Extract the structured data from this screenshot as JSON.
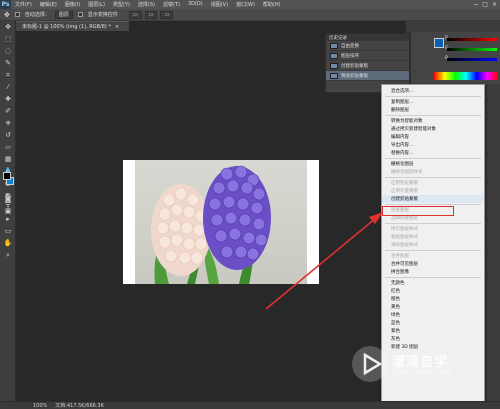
{
  "menubar": {
    "logo": "Ps",
    "items": [
      "文件(F)",
      "编辑(E)",
      "图像(I)",
      "图层(L)",
      "类型(Y)",
      "选择(S)",
      "滤镜(T)",
      "3D(D)",
      "视图(V)",
      "窗口(W)",
      "帮助(H)"
    ],
    "window_controls": [
      "−",
      "□",
      "×"
    ]
  },
  "options_bar": {
    "auto_select_label": "自动选择：",
    "auto_select_value": "图层",
    "show_transform_label": "显示变换控件"
  },
  "document": {
    "tab_title": "未标题-1 @ 100% (img (1), RGB/8) *"
  },
  "history_panel": {
    "title": "历史记录",
    "rows": [
      "自由变换",
      "图层排序",
      "创建剪贴蒙版",
      "释放剪贴蒙版"
    ]
  },
  "color_panel": {
    "labels": [
      "R",
      "G",
      "B"
    ]
  },
  "context_menu": {
    "items": [
      {
        "label": "混合选项...",
        "disabled": false
      },
      {
        "sep": true
      },
      {
        "label": "复制图层...",
        "disabled": false
      },
      {
        "label": "删除图层",
        "disabled": false
      },
      {
        "sep": true
      },
      {
        "label": "转换为智能对象",
        "disabled": false
      },
      {
        "label": "通过拷贝新建智能对象",
        "disabled": false
      },
      {
        "label": "编辑内容",
        "disabled": false
      },
      {
        "label": "导出内容...",
        "disabled": false
      },
      {
        "label": "替换内容...",
        "disabled": false
      },
      {
        "sep": true
      },
      {
        "label": "栅格化图层",
        "disabled": false
      },
      {
        "label": "栅格化图层样式",
        "disabled": true
      },
      {
        "sep": true
      },
      {
        "label": "启用图层蒙版",
        "disabled": true
      },
      {
        "label": "启用矢量蒙版",
        "disabled": true
      },
      {
        "label": "创建剪贴蒙版",
        "disabled": false,
        "highlight": true
      },
      {
        "sep": true
      },
      {
        "label": "链接图层",
        "disabled": true
      },
      {
        "label": "选择链接图层",
        "disabled": true
      },
      {
        "sep": true
      },
      {
        "label": "拷贝图层样式",
        "disabled": true
      },
      {
        "label": "粘贴图层样式",
        "disabled": true
      },
      {
        "label": "清除图层样式",
        "disabled": true
      },
      {
        "sep": true
      },
      {
        "label": "合并图层",
        "disabled": true
      },
      {
        "label": "合并可见图层",
        "disabled": false
      },
      {
        "label": "拼合图像",
        "disabled": false
      },
      {
        "sep": true
      },
      {
        "label": "无颜色",
        "disabled": false
      },
      {
        "label": "红色",
        "disabled": false
      },
      {
        "label": "橙色",
        "disabled": false
      },
      {
        "label": "黄色",
        "disabled": false
      },
      {
        "label": "绿色",
        "disabled": false
      },
      {
        "label": "蓝色",
        "disabled": false
      },
      {
        "label": "紫色",
        "disabled": false
      },
      {
        "label": "灰色",
        "disabled": false
      }
    ],
    "bottom_partial": "新建 3D 图层"
  },
  "statusbar": {
    "zoom": "100%",
    "doc_info": "文档:417.5K/666.3K"
  },
  "watermark": {
    "title": "溜溜自学",
    "url": "ZIXUE.3D66.COM"
  },
  "colors": {
    "highlight_border": "#e03030",
    "foreground_swatch": "#000000",
    "background_swatch": "#0a84d6"
  }
}
